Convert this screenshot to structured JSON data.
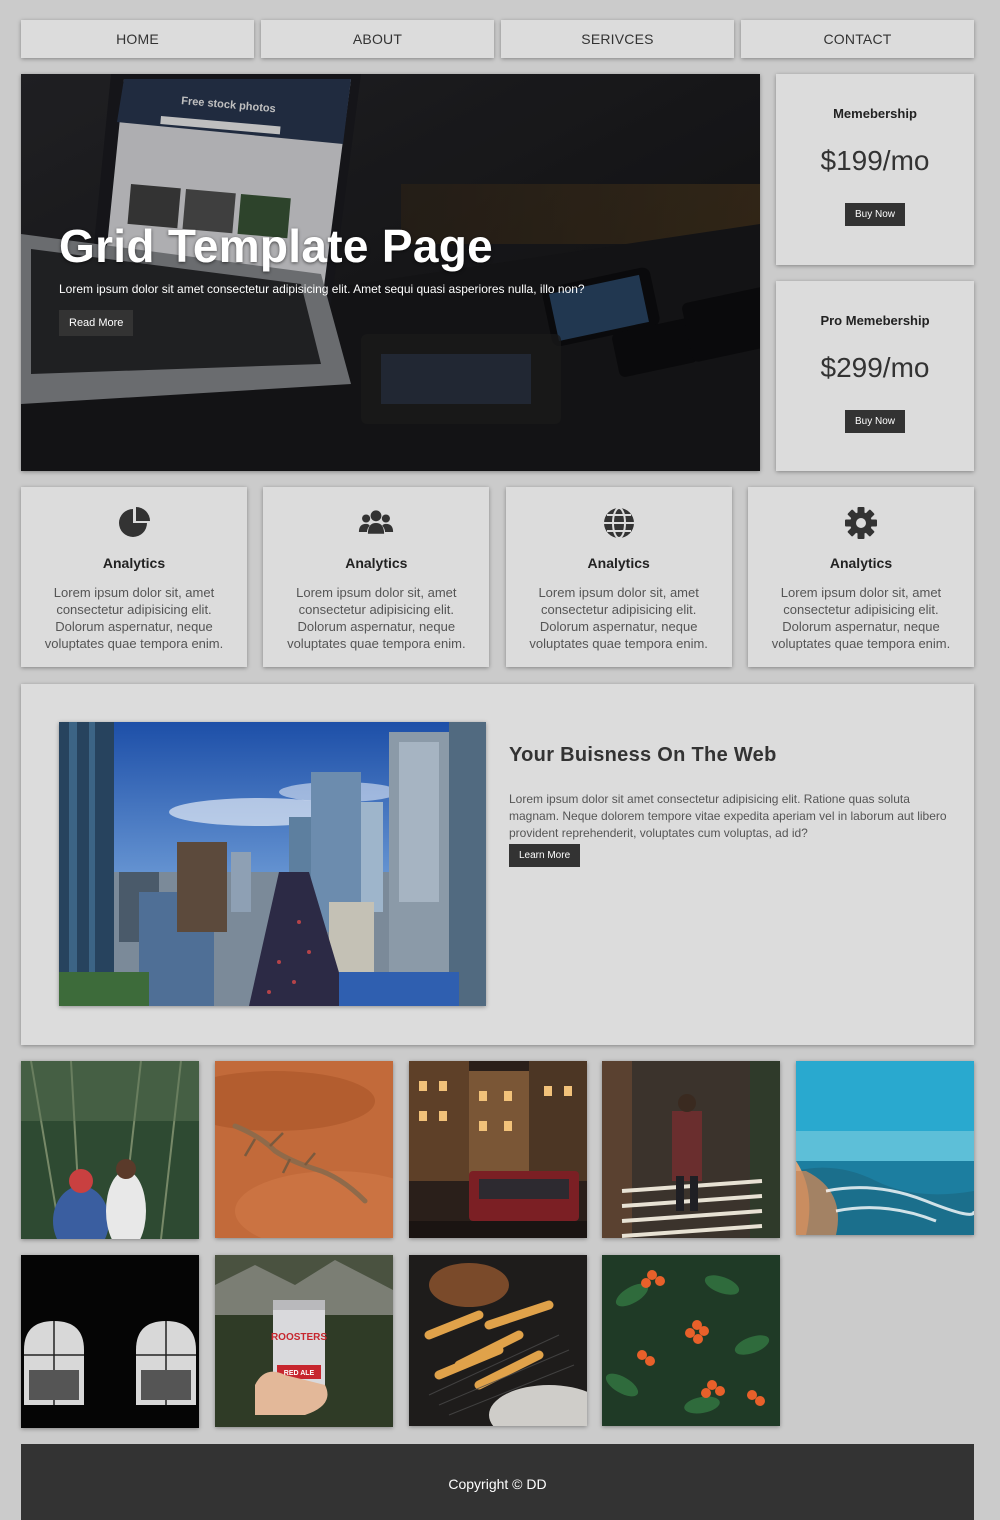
{
  "nav": {
    "items": [
      {
        "label": "HOME"
      },
      {
        "label": "ABOUT"
      },
      {
        "label": "SERIVCES"
      },
      {
        "label": "CONTACT"
      }
    ]
  },
  "hero": {
    "title": "Grid Template Page",
    "subtitle": "Lorem ipsum dolor sit amet consectetur adipisicing elit. Amet sequi quasi asperiores nulla, illo non?",
    "button": "Read More",
    "laptop_screen_heading": "Free stock photos"
  },
  "memberships": [
    {
      "title": "Memebership",
      "price": "$199/mo",
      "button": "Buy Now"
    },
    {
      "title": "Pro Memebership",
      "price": "$299/mo",
      "button": "Buy Now"
    }
  ],
  "features": [
    {
      "icon": "pie-chart-icon",
      "title": "Analytics",
      "text": "Lorem ipsum dolor sit, amet consectetur adipisicing elit. Dolorum aspernatur, neque voluptates quae tempora enim."
    },
    {
      "icon": "users-icon",
      "title": "Analytics",
      "text": "Lorem ipsum dolor sit, amet consectetur adipisicing elit. Dolorum aspernatur, neque voluptates quae tempora enim."
    },
    {
      "icon": "globe-icon",
      "title": "Analytics",
      "text": "Lorem ipsum dolor sit, amet consectetur adipisicing elit. Dolorum aspernatur, neque voluptates quae tempora enim."
    },
    {
      "icon": "gear-icon",
      "title": "Analytics",
      "text": "Lorem ipsum dolor sit, amet consectetur adipisicing elit. Dolorum aspernatur, neque voluptates quae tempora enim."
    }
  ],
  "business": {
    "title": "Your Buisness On The Web",
    "text": "Lorem ipsum dolor sit amet consectetur adipisicing elit. Ratione quas soluta magnam. Neque dolorem tempore vitae expedita aperiam vel in laborum aut libero provident reprehenderit, voluptates cum voluptas, ad id?",
    "button": "Learn More"
  },
  "gallery": {
    "photos": [
      "forest-people-photo",
      "lizard-sand-photo",
      "city-street-night-photo",
      "walkway-person-photo",
      "ocean-beach-photo",
      "arched-windows-photo",
      "beer-can-photo",
      "fries-basket-photo",
      "orange-berries-photo"
    ],
    "beer_can_text": "ROOSTERS",
    "beer_can_label": "RED ALE"
  },
  "footer": {
    "copyright": "Copyright © DD"
  }
}
